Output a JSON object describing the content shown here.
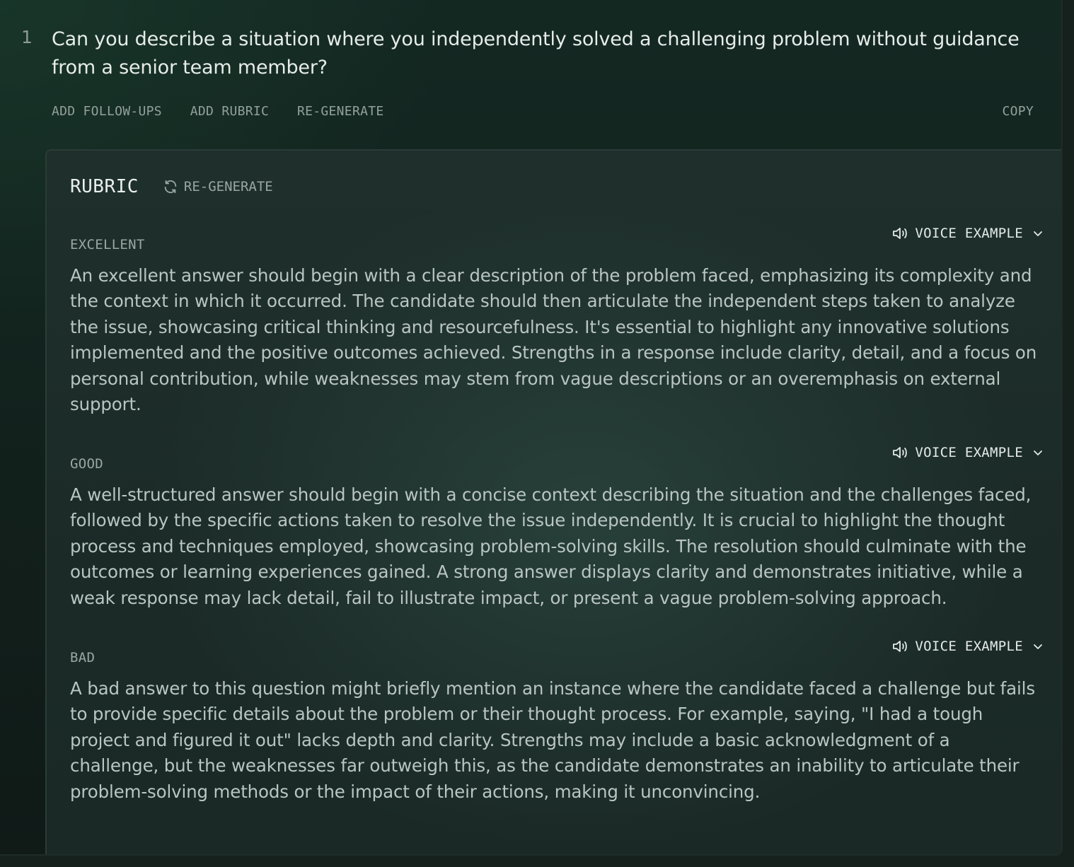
{
  "question": {
    "number": "1",
    "text": "Can you describe a situation where you independently solved a challenging problem without guidance from a senior team member?"
  },
  "actions": {
    "add_followups": "ADD FOLLOW-UPS",
    "add_rubric": "ADD RUBRIC",
    "regenerate": "RE-GENERATE",
    "copy": "COPY"
  },
  "rubric": {
    "title": "RUBRIC",
    "regenerate_label": "RE-GENERATE",
    "sections": [
      {
        "label": "EXCELLENT",
        "voice_label": "VOICE EXAMPLE",
        "text": "An excellent answer should begin with a clear description of the problem faced, emphasizing its complexity and the context in which it occurred. The candidate should then articulate the independent steps taken to analyze the issue, showcasing critical thinking and resourcefulness. It's essential to highlight any innovative solutions implemented and the positive outcomes achieved. Strengths in a response include clarity, detail, and a focus on personal contribution, while weaknesses may stem from vague descriptions or an overemphasis on external support."
      },
      {
        "label": "GOOD",
        "voice_label": "VOICE EXAMPLE",
        "text": "A well-structured answer should begin with a concise context describing the situation and the challenges faced, followed by the specific actions taken to resolve the issue independently. It is crucial to highlight the thought process and techniques employed, showcasing problem-solving skills. The resolution should culminate with the outcomes or learning experiences gained. A strong answer displays clarity and demonstrates initiative, while a weak response may lack detail, fail to illustrate impact, or present a vague problem-solving approach."
      },
      {
        "label": "BAD",
        "voice_label": "VOICE EXAMPLE",
        "text": "A bad answer to this question might briefly mention an instance where the candidate faced a challenge but fails to provide specific details about the problem or their thought process. For example, saying, \"I had a tough project and figured it out\" lacks depth and clarity. Strengths may include a basic acknowledgment of a challenge, but the weaknesses far outweigh this, as the candidate demonstrates an inability to articulate their problem-solving methods or the impact of their actions, making it unconvincing."
      }
    ]
  },
  "icons": {
    "regenerate": "refresh-icon",
    "voice": "speaker-icon",
    "dropdown": "chevron-down-icon"
  }
}
